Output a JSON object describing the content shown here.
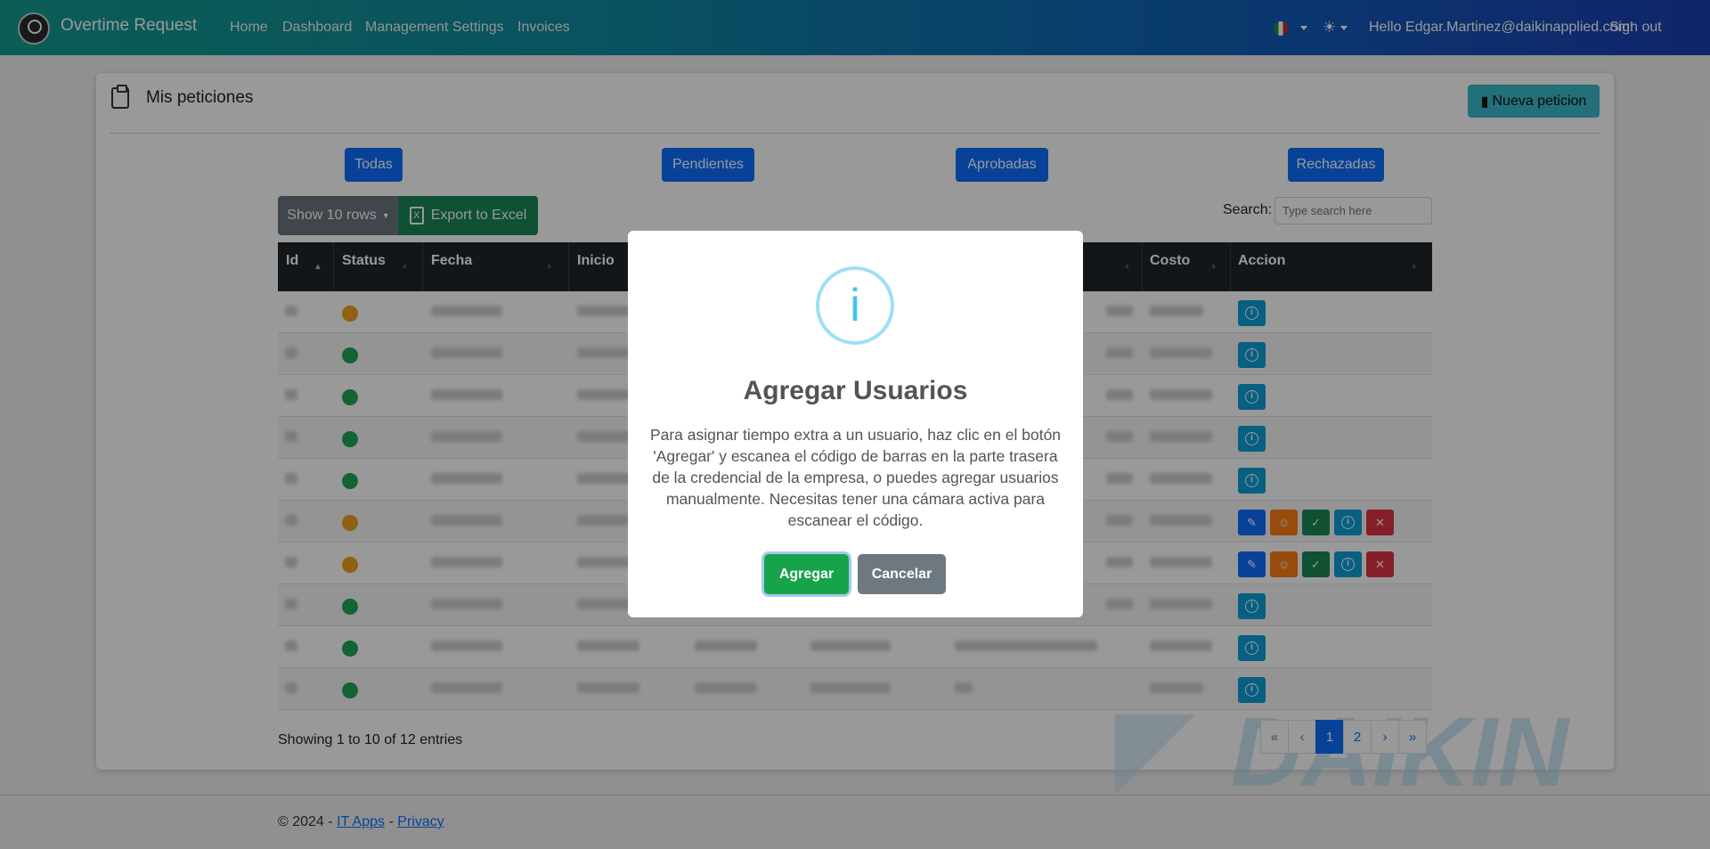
{
  "navbar": {
    "brand": "Overtime Request",
    "links": [
      "Home",
      "Dashboard",
      "Management Settings",
      "Invoices"
    ],
    "greeting": "Hello Edgar.Martinez@daikinapplied.com!",
    "signout": "Sign out"
  },
  "card": {
    "title": "Mis peticiones",
    "new_button": "Nueva peticion"
  },
  "filters": [
    "Todas",
    "Pendientes",
    "Aprobadas",
    "Rechazadas"
  ],
  "toolbar": {
    "show_rows": "Show 10 rows",
    "export": "Export to Excel",
    "search_label": "Search:",
    "search_placeholder": "Type search here"
  },
  "table": {
    "headers": [
      "Id",
      "Status",
      "Fecha",
      "Inicio",
      "Costo",
      "Accion"
    ],
    "rows": [
      {
        "status": "pending"
      },
      {
        "status": "approved"
      },
      {
        "status": "approved"
      },
      {
        "status": "approved"
      },
      {
        "status": "approved"
      },
      {
        "status": "pending"
      },
      {
        "status": "pending"
      },
      {
        "status": "approved"
      },
      {
        "status": "approved"
      },
      {
        "status": "approved"
      }
    ]
  },
  "footer_info": {
    "showing": "Showing 1 to 10 of 12 entries",
    "pages": [
      "«",
      "‹",
      "1",
      "2",
      "›",
      "»"
    ],
    "active_page": "1"
  },
  "footer": {
    "prefix": "© 2024 -",
    "it_apps": "IT Apps",
    "sep": "-",
    "privacy": "Privacy"
  },
  "watermark": "DAIKIN",
  "modal": {
    "icon": "i",
    "title": "Agregar Usuarios",
    "text": "Para asignar tiempo extra a un usuario, haz clic en el botón 'Agregar' y escanea el código de barras en la parte trasera de la credencial de la empresa, o puedes agregar usuarios manualmente. Necesitas tener una cámara activa para escanear el código.",
    "confirm": "Agregar",
    "cancel": "Cancelar"
  },
  "colors": {
    "pending": "#f0a020",
    "approved": "#22a559",
    "primary": "#0d6efd"
  }
}
